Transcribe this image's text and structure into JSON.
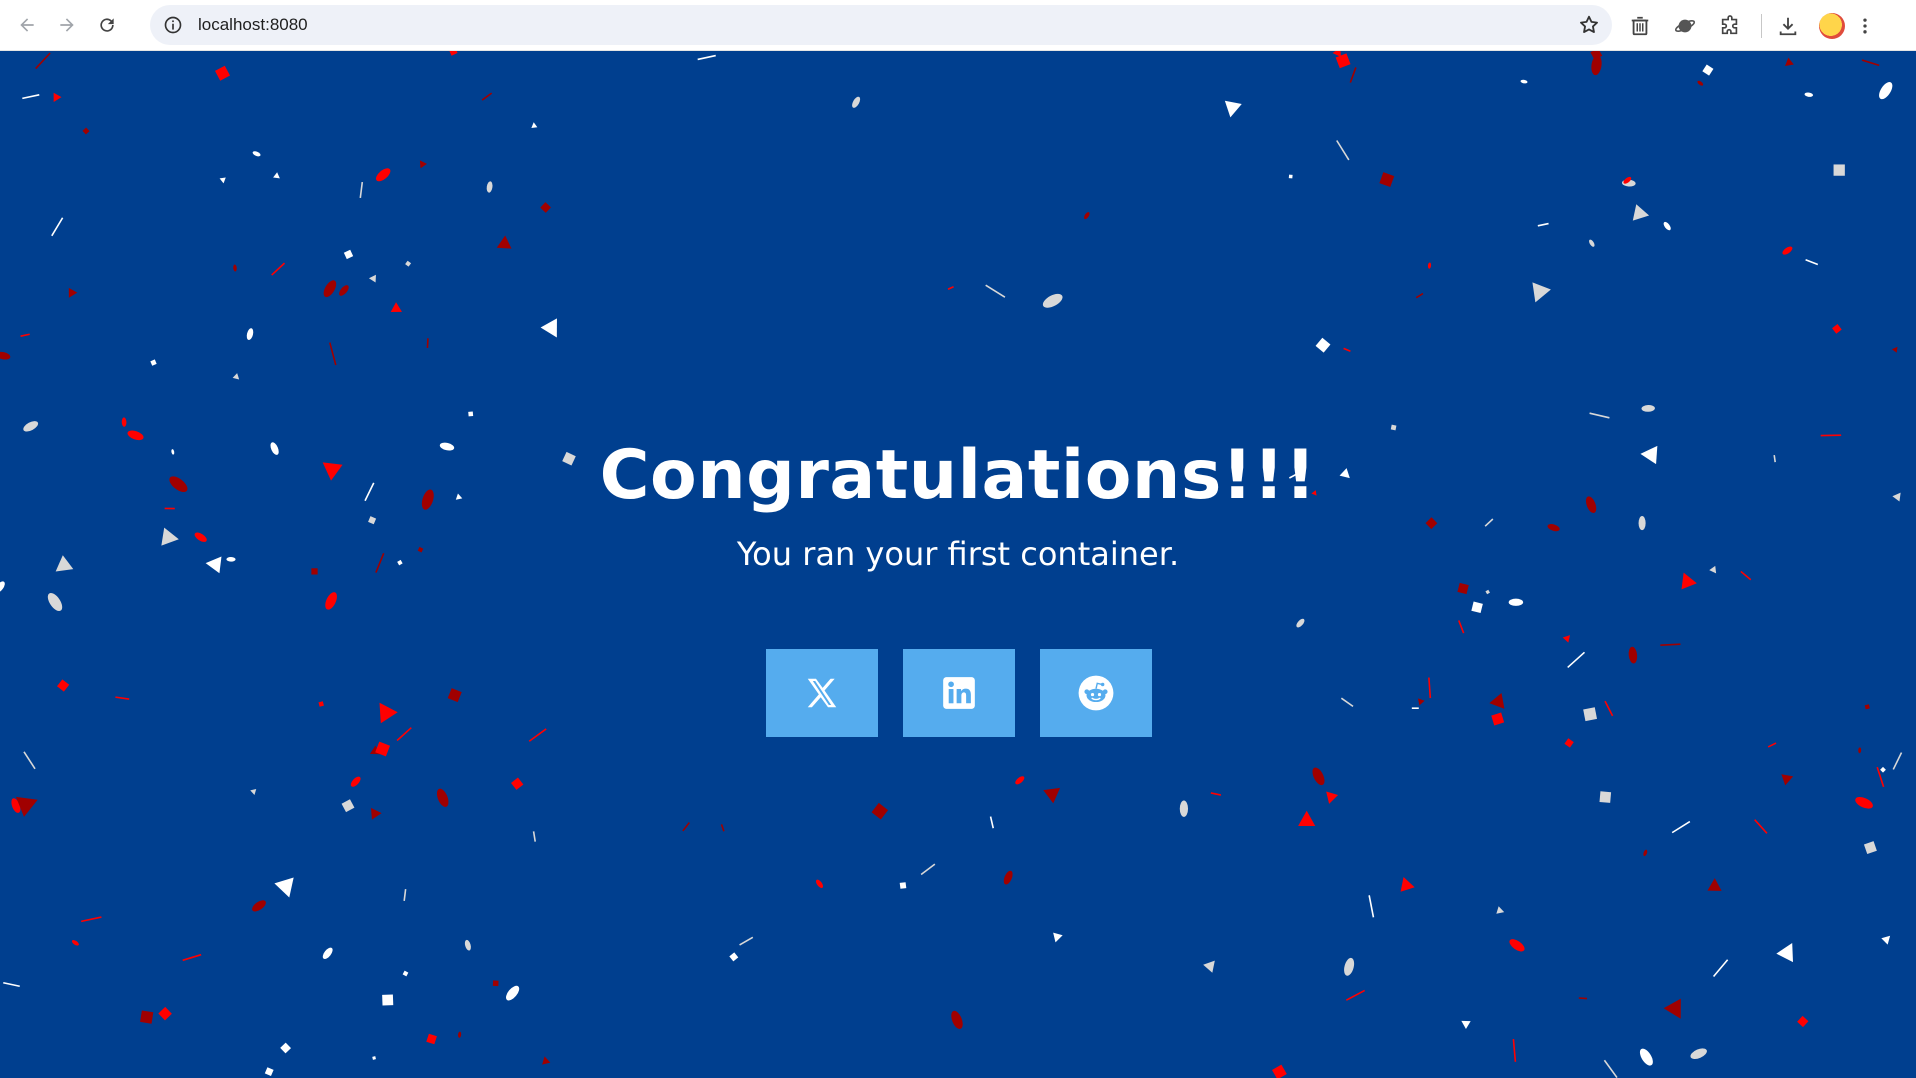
{
  "browser": {
    "url": "localhost:8080",
    "icons": [
      "back-icon",
      "forward-icon",
      "reload-icon",
      "site-info-icon",
      "bookmark-star-icon",
      "extension-trash-icon",
      "extension-planet-icon",
      "extensions-puzzle-icon",
      "downloads-icon",
      "profile-avatar",
      "menu-kebab-icon"
    ]
  },
  "page": {
    "title": "Congratulations!!!",
    "subtitle": "You ran your first container.",
    "background_color": "#003f8f",
    "share_buttons": [
      {
        "icon": "x-twitter-icon",
        "color": "#55acee"
      },
      {
        "icon": "linkedin-icon",
        "color": "#55acee"
      },
      {
        "icon": "reddit-icon",
        "color": "#55acee"
      }
    ],
    "confetti_colors": [
      "#ffffff",
      "#d8d8d8",
      "#ff0000",
      "#a00000"
    ]
  }
}
